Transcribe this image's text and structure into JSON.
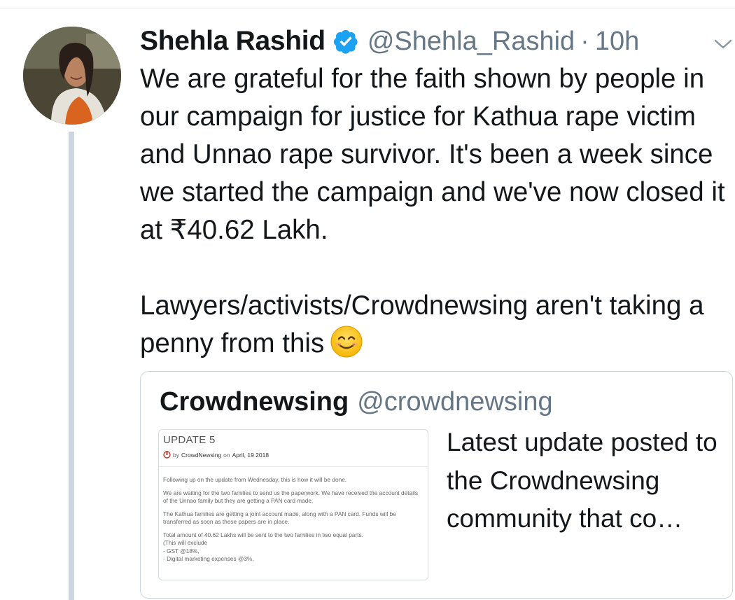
{
  "tweet": {
    "author_name": "Shehla Rashid",
    "author_handle": "@Shehla_Rashid",
    "separator": "·",
    "time": "10h",
    "verified_icon": "verified-badge-icon",
    "avatar_icon": "user-avatar",
    "caret_icon": "chevron-down-icon",
    "text": "We are grateful for the faith shown by people in our campaign for justice for Kathua rape victim and Unnao rape survivor. It's been a week since we started the campaign and we've now closed it at ₹40.62 Lakh.\n\nLawyers/activists/Crowdnewsing aren't taking a penny from this",
    "emoji_icon": "smiling-face-emoji",
    "colors": {
      "verified": "#1da1f2",
      "secondary_text": "#657786",
      "primary_text": "#14171a"
    }
  },
  "quoted_tweet": {
    "author_name": "Crowdnewsing",
    "author_handle": "@crowdnewsing",
    "text": "Latest update posted to the Crowdnewsing community that co…",
    "image": {
      "title": "UPDATE 5",
      "by_prefix": "by",
      "org": "CrowdNewsing",
      "on_word": "on",
      "date": "April, 19 2018",
      "paragraphs": [
        "Following up on the update from Wednesday, this is how it will be done.",
        "We are waiting for the two families to send us the paperwork. We have received the account details of the Unnao family but they are getting a PAN card made.",
        "The Kathua families are getting a joint account made, along with a PAN card. Funds will be transferred as soon as these papers are in place."
      ],
      "closing_lines": [
        "Total amount of 40.62 Lakhs will be sent to the two families in two equal parts.",
        "(This will exclude",
        "- GST @18%,",
        "- Digital marketing expenses @3%,"
      ]
    }
  }
}
